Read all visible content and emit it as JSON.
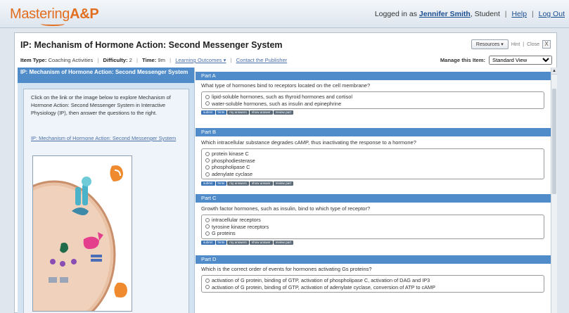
{
  "brand": {
    "name_main": "Mastering",
    "name_accent": "A&P"
  },
  "user": {
    "prefix": "Logged in as",
    "name": "Jennifer Smith",
    "role": ", Student",
    "help": "Help",
    "logout": "Log Out"
  },
  "assignment": {
    "title": "IP: Mechanism of Hormone Action: Second Messenger System",
    "resources_label": "Resources ▾",
    "hint_link": "Hint",
    "close_link": "Close",
    "close_x": "X",
    "meta": {
      "item_type_label": "Item Type:",
      "item_type": "Coaching Activities",
      "difficulty_label": "Difficulty:",
      "difficulty": "2",
      "time_label": "Time:",
      "time": "9m",
      "learning_outcomes": "Learning Outcomes ▾",
      "contact": "Contact the Publisher"
    },
    "manage": {
      "label": "Manage this Item:",
      "selected": "Standard View"
    }
  },
  "left_panel": {
    "heading": "IP: Mechanism of Hormone Action: Second Messenger System",
    "intro": "Click on the link or the image below to explore Mechanism of Hormone Action: Second Messenger System in Interactive Physiology (IP), then answer the questions to the right.",
    "link": "IP: Mechanism of Hormone Action: Second Messenger System"
  },
  "action_buttons": [
    "submit",
    "hints",
    "my answers",
    "show answer",
    "review part"
  ],
  "parts": [
    {
      "label": "Part A",
      "question": "What type of hormones bind to receptors located on the cell membrane?",
      "options": [
        "lipid-soluble hormones, such as thyroid hormones and cortisol",
        "water-soluble hormones, such as insulin and epinephrine"
      ]
    },
    {
      "label": "Part B",
      "question": "Which intracellular substance degrades cAMP, thus inactivating the response to a hormone?",
      "options": [
        "protein kinase C",
        "phosphodiesterase",
        "phospholipase C",
        "adenylate cyclase"
      ]
    },
    {
      "label": "Part C",
      "question": "Growth factor hormones, such as insulin, bind to which type of receptor?",
      "options": [
        "intracellular receptors",
        "tyrosine kinase receptors",
        "G proteins"
      ]
    },
    {
      "label": "Part D",
      "question": "Which is the correct order of events for hormones activating Gs proteins?",
      "options": [
        "activation of G protein, binding of GTP, activation of phospholipase C, activation of DAG and IP3",
        "activation of G protein, binding of GTP, activation of adenylate cyclase, conversion of ATP to cAMP"
      ]
    }
  ],
  "colors": {
    "brand_orange": "#e36d1f",
    "part_header_blue": "#4f8cc9",
    "link_blue": "#1a4d8f"
  }
}
